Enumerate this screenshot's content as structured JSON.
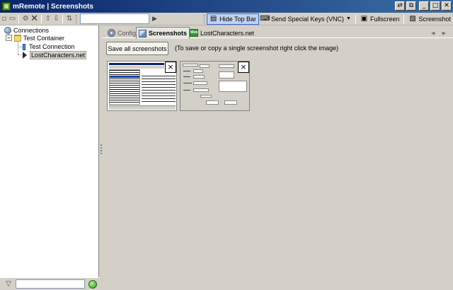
{
  "window": {
    "title": "mRemote | Screenshots",
    "buttons": [
      "⇄",
      "⧉",
      "_",
      "□",
      "✕"
    ]
  },
  "toolbar": {
    "url_value": "",
    "hide_top_bar": "Hide Top Bar",
    "send_special_keys": "Send Special Keys (VNC)",
    "fullscreen": "Fullscreen",
    "screenshot": "Screenshot"
  },
  "tree": {
    "root": "Connections",
    "container": "Test Container",
    "items": [
      {
        "label": "Test Connection"
      },
      {
        "label": "LostCharacters.net",
        "selected": true
      }
    ],
    "expander_symbol": "−"
  },
  "tabs": [
    {
      "label": "Config",
      "icon": "gear-icon",
      "active": false
    },
    {
      "label": "Screenshots",
      "icon": "screenshot-icon",
      "active": true
    },
    {
      "label": "LostCharacters.net",
      "icon": "web-icon",
      "icon_text": "Web",
      "active": false
    }
  ],
  "tab_nav": "◀ ▶",
  "screenshots_panel": {
    "save_all_label": "Save all screenshots",
    "hint": "(To save or copy a single screenshot right click the image)",
    "thumbnail_close": "×"
  },
  "bottom": {
    "filter_value": ""
  }
}
